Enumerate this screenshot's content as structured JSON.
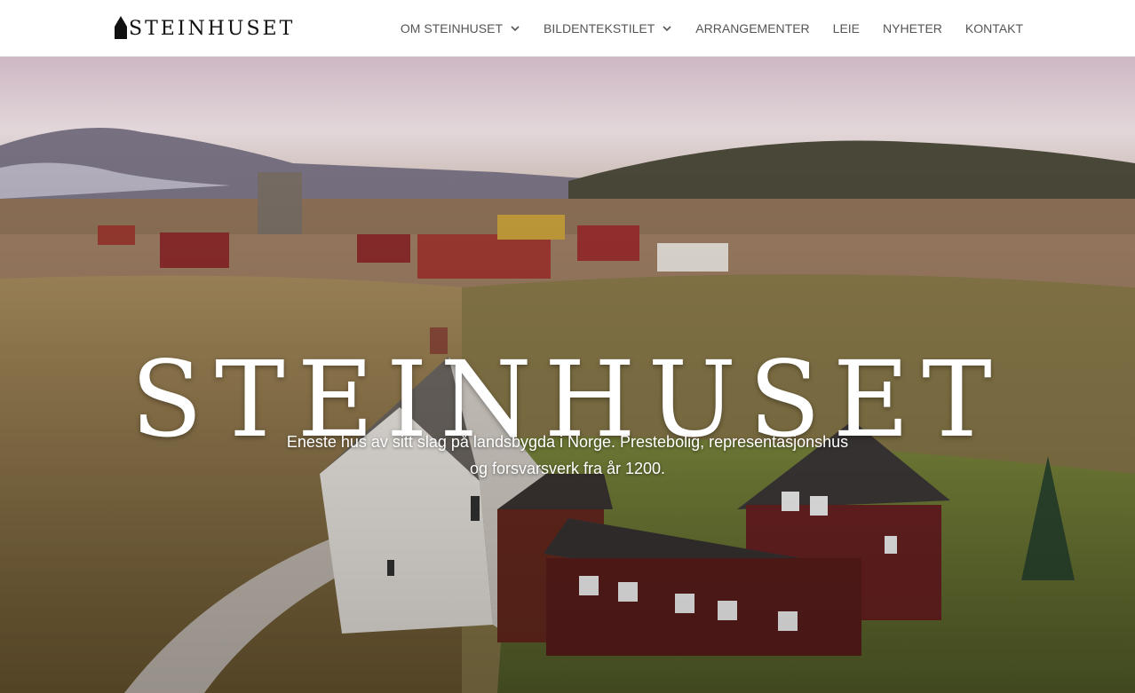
{
  "header": {
    "logo_text": "STEINHUSET",
    "logo_icon": "house-silhouette-icon",
    "nav": [
      {
        "label": "OM STEINHUSET",
        "has_dropdown": true
      },
      {
        "label": "BILDENTEKSTILET",
        "has_dropdown": true
      },
      {
        "label": "ARRANGEMENTER",
        "has_dropdown": false
      },
      {
        "label": "LEIE",
        "has_dropdown": false
      },
      {
        "label": "NYHETER",
        "has_dropdown": false
      },
      {
        "label": "KONTAKT",
        "has_dropdown": false
      }
    ]
  },
  "hero": {
    "title": "STEINHUSET",
    "subtitle": "Eneste hus av sitt slag på landsbygda i Norge. Prestebolig, representasjonshus og forsvarsverk fra år 1200."
  },
  "colors": {
    "nav_text": "#555555",
    "hero_text": "#ffffff",
    "header_bg": "#ffffff"
  }
}
